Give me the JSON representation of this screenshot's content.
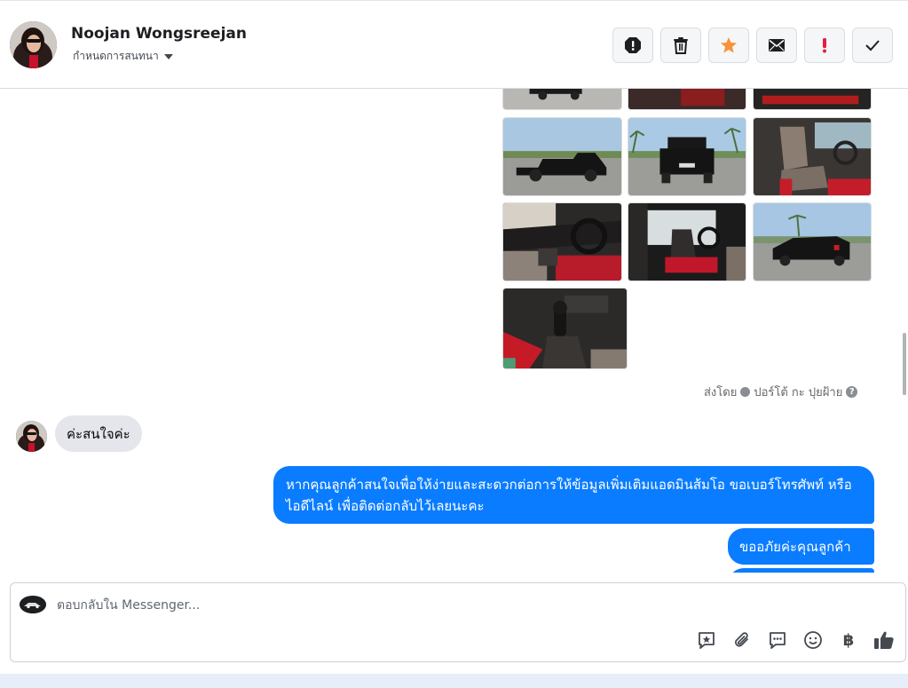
{
  "header": {
    "contact_name": "Noojan Wongsreejan",
    "assign_label": "กำหนดการสนทนา",
    "actions": [
      {
        "name": "report-button",
        "icon": "alert-circle-icon"
      },
      {
        "name": "delete-button",
        "icon": "trash-icon"
      },
      {
        "name": "star-button",
        "icon": "star-icon"
      },
      {
        "name": "mark-unread-button",
        "icon": "envelope-icon"
      },
      {
        "name": "flag-important-button",
        "icon": "exclamation-icon"
      },
      {
        "name": "mark-done-button",
        "icon": "checkmark-icon"
      }
    ]
  },
  "conversation": {
    "sent_by_prefix": "ส่งโดย",
    "sent_by_name": "ปอร์โต้ กะ ปุยฝ้าย",
    "help_glyph": "?",
    "incoming_message": "ค่ะสนใจค่ะ",
    "outgoing_messages": [
      "หากคุณลูกค้าสนใจเพื่อให้ง่ายและสะดวกต่อการให้ข้อมูลเพิ่มเติมแอดมินส้มโอ ขอเบอร์โทรศัพท์ หรือ ไอดีไลน์ เพื่อติดต่อกลับไว้เลยนะคะ",
      "ขออภัยค่ะคุณลูกค้า"
    ]
  },
  "composer": {
    "placeholder": "ตอบกลับใน Messenger...",
    "baht_glyph": "฿"
  },
  "colors": {
    "messenger_blue": "#0a7cff",
    "star_orange": "#f7923b",
    "flag_red": "#e41e3f"
  }
}
